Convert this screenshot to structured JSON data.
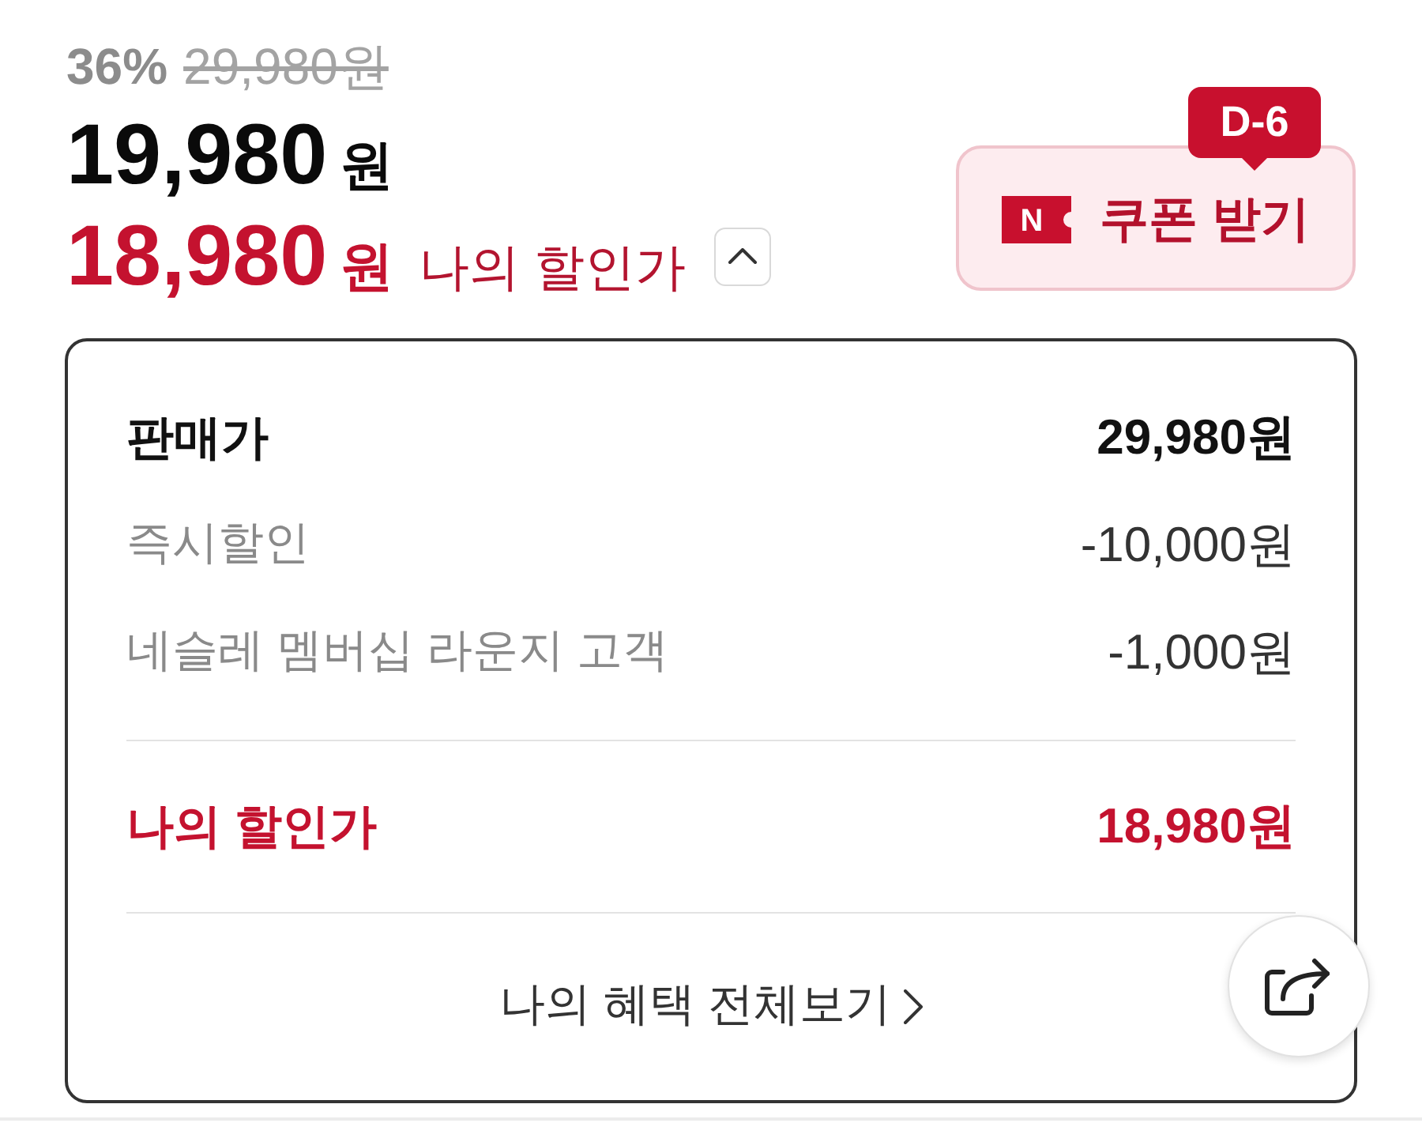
{
  "price": {
    "discount_rate": "36%",
    "original_price": "29,980원",
    "sale_amount": "19,980",
    "sale_unit": "원",
    "my_amount": "18,980",
    "my_unit": "원",
    "my_label": "나의 할인가",
    "expanded": true
  },
  "coupon": {
    "badge": "D-6",
    "logo_letter": "N",
    "label": "쿠폰 받기"
  },
  "breakdown": {
    "rows": [
      {
        "kind": "base",
        "label": "판매가",
        "value": "29,980원"
      },
      {
        "kind": "discount",
        "label": "즉시할인",
        "value": "-10,000원"
      },
      {
        "kind": "discount",
        "label": "네슬레 멤버십 라운지 고객",
        "value": "-1,000원"
      }
    ],
    "total": {
      "label": "나의 할인가",
      "value": "18,980원"
    },
    "link": "나의 혜택 전체보기"
  }
}
